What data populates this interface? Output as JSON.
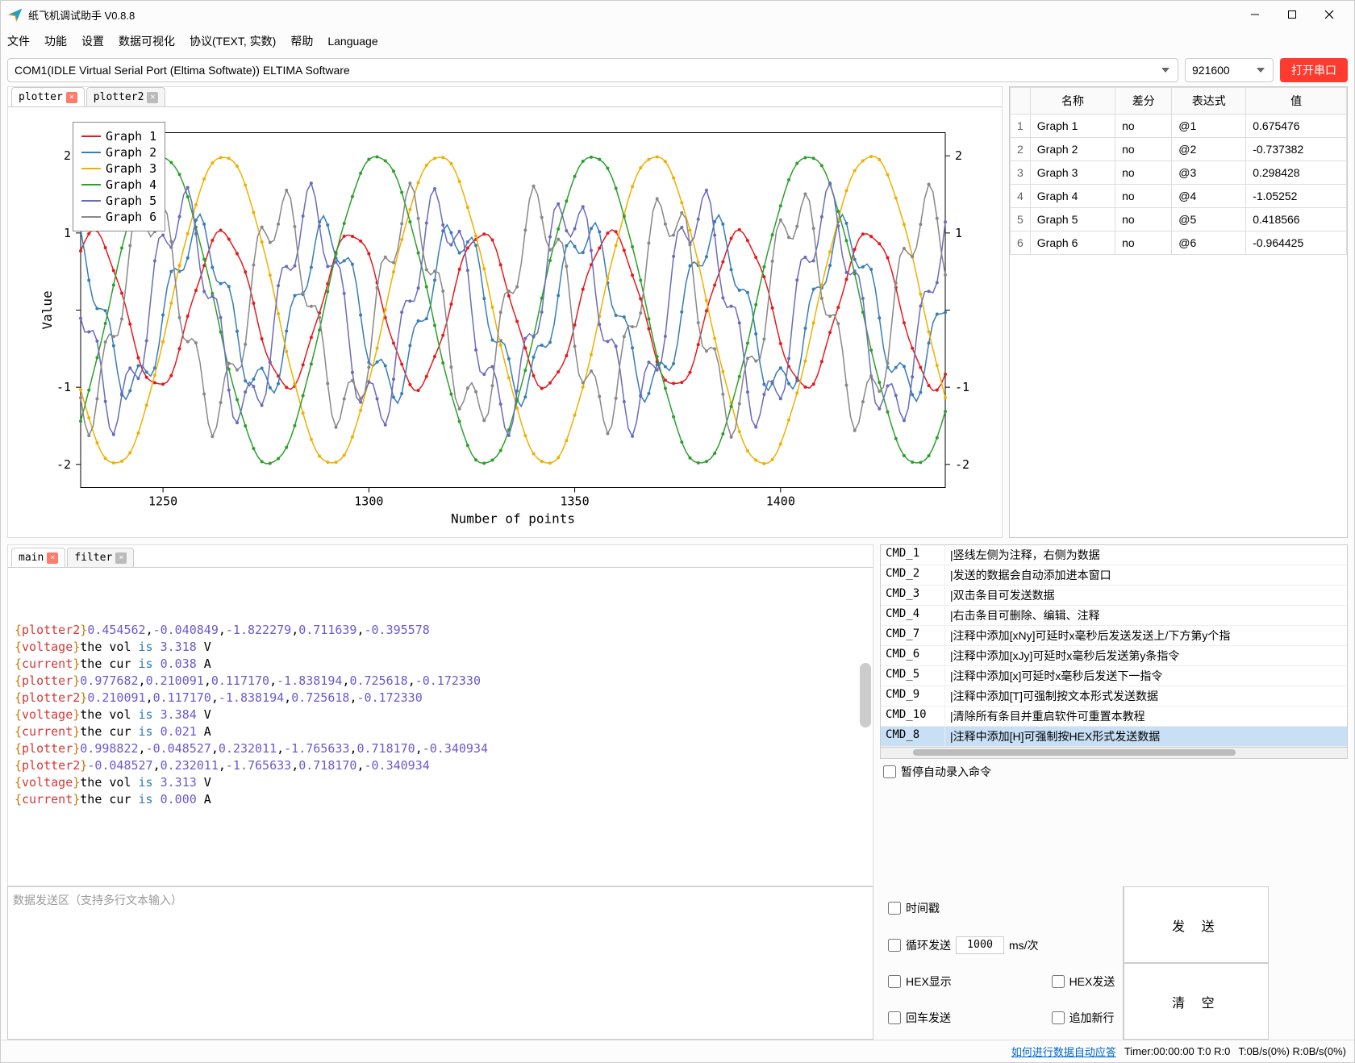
{
  "window": {
    "title": "纸飞机调试助手 V0.8.8"
  },
  "menu": [
    "文件",
    "功能",
    "设置",
    "数据可视化",
    "协议(TEXT, 实数)",
    "帮助",
    "Language"
  ],
  "conn": {
    "port": "COM1(IDLE  Virtual Serial Port (Eltima Softwate)) ELTIMA Software",
    "baud": "921600",
    "open_label": "打开串口"
  },
  "plot_tabs": [
    {
      "label": "plotter",
      "active": true,
      "close_gray": false
    },
    {
      "label": "plotter2",
      "active": false,
      "close_gray": true
    }
  ],
  "chart_data": {
    "type": "line",
    "xlabel": "Number of points",
    "ylabel": "Value",
    "xlim": [
      1230,
      1440
    ],
    "ylim": [
      -2.3,
      2.3
    ],
    "xticks": [
      1250,
      1300,
      1350,
      1400
    ],
    "yticks": [
      -2,
      -1,
      0,
      1,
      2
    ],
    "series": [
      {
        "name": "Graph 1",
        "color": "#e41a1c",
        "amp": 1.0,
        "freq": 0.2,
        "phase": 0.0,
        "noise": 0.05
      },
      {
        "name": "Graph 2",
        "color": "#377eb8",
        "amp": 1.0,
        "freq": 0.2,
        "phase": 1.2,
        "noise": 0.25
      },
      {
        "name": "Graph 3",
        "color": "#f0b000",
        "amp": 2.0,
        "freq": 0.12,
        "phase": 0.6,
        "noise": 0.02
      },
      {
        "name": "Graph 4",
        "color": "#2ca02c",
        "amp": 2.0,
        "freq": 0.12,
        "phase": 2.4,
        "noise": 0.02
      },
      {
        "name": "Graph 5",
        "color": "#6b6bbd",
        "amp": 1.3,
        "freq": 0.2,
        "phase": 2.0,
        "noise": 0.35
      },
      {
        "name": "Graph 6",
        "color": "#888888",
        "amp": 1.3,
        "freq": 0.2,
        "phase": 3.5,
        "noise": 0.35
      }
    ]
  },
  "data_table": {
    "headers": [
      "名称",
      "差分",
      "表达式",
      "值"
    ],
    "rows": [
      {
        "idx": "1",
        "name": "Graph 1",
        "diff": "no",
        "expr": "@1",
        "val": "0.675476"
      },
      {
        "idx": "2",
        "name": "Graph 2",
        "diff": "no",
        "expr": "@2",
        "val": "-0.737382"
      },
      {
        "idx": "3",
        "name": "Graph 3",
        "diff": "no",
        "expr": "@3",
        "val": "0.298428"
      },
      {
        "idx": "4",
        "name": "Graph 4",
        "diff": "no",
        "expr": "@4",
        "val": "-1.05252"
      },
      {
        "idx": "5",
        "name": "Graph 5",
        "diff": "no",
        "expr": "@5",
        "val": "0.418566"
      },
      {
        "idx": "6",
        "name": "Graph 6",
        "diff": "no",
        "expr": "@6",
        "val": "-0.964425"
      }
    ]
  },
  "term_tabs": [
    {
      "label": "main",
      "active": true,
      "close_gray": false
    },
    {
      "label": "filter",
      "active": false,
      "close_gray": true
    }
  ],
  "term_lines": [
    [
      [
        "{",
        "brace"
      ],
      [
        "plotter2",
        "tag"
      ],
      [
        "}",
        "brace"
      ],
      [
        "0.454562",
        "num"
      ],
      [
        ",",
        ""
      ],
      [
        "-0.040849",
        "num"
      ],
      [
        ",",
        ""
      ],
      [
        "-1.822279",
        "num"
      ],
      [
        ",",
        ""
      ],
      [
        "0.711639",
        "num"
      ],
      [
        ",",
        ""
      ],
      [
        "-0.395578",
        "num"
      ]
    ],
    [
      [
        "{",
        "brace"
      ],
      [
        "voltage",
        "tag"
      ],
      [
        "}",
        "brace"
      ],
      [
        "the vol ",
        ""
      ],
      [
        "is",
        "kw"
      ],
      [
        " ",
        ""
      ],
      [
        "3.318",
        "num"
      ],
      [
        " V",
        ""
      ]
    ],
    [
      [
        "{",
        "brace"
      ],
      [
        "current",
        "tag"
      ],
      [
        "}",
        "brace"
      ],
      [
        "the cur ",
        ""
      ],
      [
        "is",
        "kw"
      ],
      [
        " ",
        ""
      ],
      [
        "0.038",
        "num"
      ],
      [
        " A",
        ""
      ]
    ],
    [
      [
        "",
        ""
      ]
    ],
    [
      [
        "{",
        "brace"
      ],
      [
        "plotter",
        "tag"
      ],
      [
        "}",
        "brace"
      ],
      [
        "0.977682",
        "num"
      ],
      [
        ",",
        ""
      ],
      [
        "0.210091",
        "num"
      ],
      [
        ",",
        ""
      ],
      [
        "0.117170",
        "num"
      ],
      [
        ",",
        ""
      ],
      [
        "-1.838194",
        "num"
      ],
      [
        ",",
        ""
      ],
      [
        "0.725618",
        "num"
      ],
      [
        ",",
        ""
      ],
      [
        "-0.172330",
        "num"
      ]
    ],
    [
      [
        "{",
        "brace"
      ],
      [
        "plotter2",
        "tag"
      ],
      [
        "}",
        "brace"
      ],
      [
        "0.210091",
        "num"
      ],
      [
        ",",
        ""
      ],
      [
        "0.117170",
        "num"
      ],
      [
        ",",
        ""
      ],
      [
        "-1.838194",
        "num"
      ],
      [
        ",",
        ""
      ],
      [
        "0.725618",
        "num"
      ],
      [
        ",",
        ""
      ],
      [
        "-0.172330",
        "num"
      ]
    ],
    [
      [
        "{",
        "brace"
      ],
      [
        "voltage",
        "tag"
      ],
      [
        "}",
        "brace"
      ],
      [
        "the vol ",
        ""
      ],
      [
        "is",
        "kw"
      ],
      [
        " ",
        ""
      ],
      [
        "3.384",
        "num"
      ],
      [
        " V",
        ""
      ]
    ],
    [
      [
        "{",
        "brace"
      ],
      [
        "current",
        "tag"
      ],
      [
        "}",
        "brace"
      ],
      [
        "the cur ",
        ""
      ],
      [
        "is",
        "kw"
      ],
      [
        " ",
        ""
      ],
      [
        "0.021",
        "num"
      ],
      [
        " A",
        ""
      ]
    ],
    [
      [
        "",
        ""
      ]
    ],
    [
      [
        "{",
        "brace"
      ],
      [
        "plotter",
        "tag"
      ],
      [
        "}",
        "brace"
      ],
      [
        "0.998822",
        "num"
      ],
      [
        ",",
        ""
      ],
      [
        "-0.048527",
        "num"
      ],
      [
        ",",
        ""
      ],
      [
        "0.232011",
        "num"
      ],
      [
        ",",
        ""
      ],
      [
        "-1.765633",
        "num"
      ],
      [
        ",",
        ""
      ],
      [
        "0.718170",
        "num"
      ],
      [
        ",",
        ""
      ],
      [
        "-0.340934",
        "num"
      ]
    ],
    [
      [
        "{",
        "brace"
      ],
      [
        "plotter2",
        "tag"
      ],
      [
        "}",
        "brace"
      ],
      [
        "-0.048527",
        "num"
      ],
      [
        ",",
        ""
      ],
      [
        "0.232011",
        "num"
      ],
      [
        ",",
        ""
      ],
      [
        "-1.765633",
        "num"
      ],
      [
        ",",
        ""
      ],
      [
        "0.718170",
        "num"
      ],
      [
        ",",
        ""
      ],
      [
        "-0.340934",
        "num"
      ]
    ],
    [
      [
        "{",
        "brace"
      ],
      [
        "voltage",
        "tag"
      ],
      [
        "}",
        "brace"
      ],
      [
        "the vol ",
        ""
      ],
      [
        "is",
        "kw"
      ],
      [
        " ",
        ""
      ],
      [
        "3.313",
        "num"
      ],
      [
        " V",
        ""
      ]
    ],
    [
      [
        "{",
        "brace"
      ],
      [
        "current",
        "tag"
      ],
      [
        "}",
        "brace"
      ],
      [
        "the cur ",
        ""
      ],
      [
        "is",
        "kw"
      ],
      [
        " ",
        ""
      ],
      [
        "0.000",
        "num"
      ],
      [
        " A",
        ""
      ]
    ]
  ],
  "cmds": [
    {
      "cmd": "CMD_1",
      "desc": "|竖线左侧为注释，右侧为数据"
    },
    {
      "cmd": "CMD_2",
      "desc": "|发送的数据会自动添加进本窗口"
    },
    {
      "cmd": "CMD_3",
      "desc": "|双击条目可发送数据"
    },
    {
      "cmd": "CMD_4",
      "desc": "|右击条目可删除、编辑、注释"
    },
    {
      "cmd": "CMD_7",
      "desc": "|注释中添加[xNy]可延时x毫秒后发送发送上/下方第y个指"
    },
    {
      "cmd": "CMD_6",
      "desc": "|注释中添加[xJy]可延时x毫秒后发送第y条指令"
    },
    {
      "cmd": "CMD_5",
      "desc": "|注释中添加[x]可延时x毫秒后发送下一指令"
    },
    {
      "cmd": "CMD_9",
      "desc": "|注释中添加[T]可强制按文本形式发送数据"
    },
    {
      "cmd": "CMD_10",
      "desc": "|清除所有条目并重启软件可重置本教程"
    },
    {
      "cmd": "CMD_8",
      "desc": "|注释中添加[H]可强制按HEX形式发送数据",
      "sel": true
    }
  ],
  "pause_label": "暂停自动录入命令",
  "send_placeholder": "数据发送区（支持多行文本输入）",
  "opts": {
    "timestamp": "时间戳",
    "loop": "循环发送",
    "loop_val": "1000",
    "loop_unit": "ms/次",
    "hex_show": "HEX显示",
    "hex_send": "HEX发送",
    "cr_send": "回车发送",
    "append": "追加新行"
  },
  "btns": {
    "send": "发 送",
    "clear": "清 空"
  },
  "status": {
    "link": "如何进行数据自动应答",
    "timer": "Timer:00:00:00 T:0 R:0",
    "rate": "T:0B/s(0%) R:0B/s(0%)"
  }
}
